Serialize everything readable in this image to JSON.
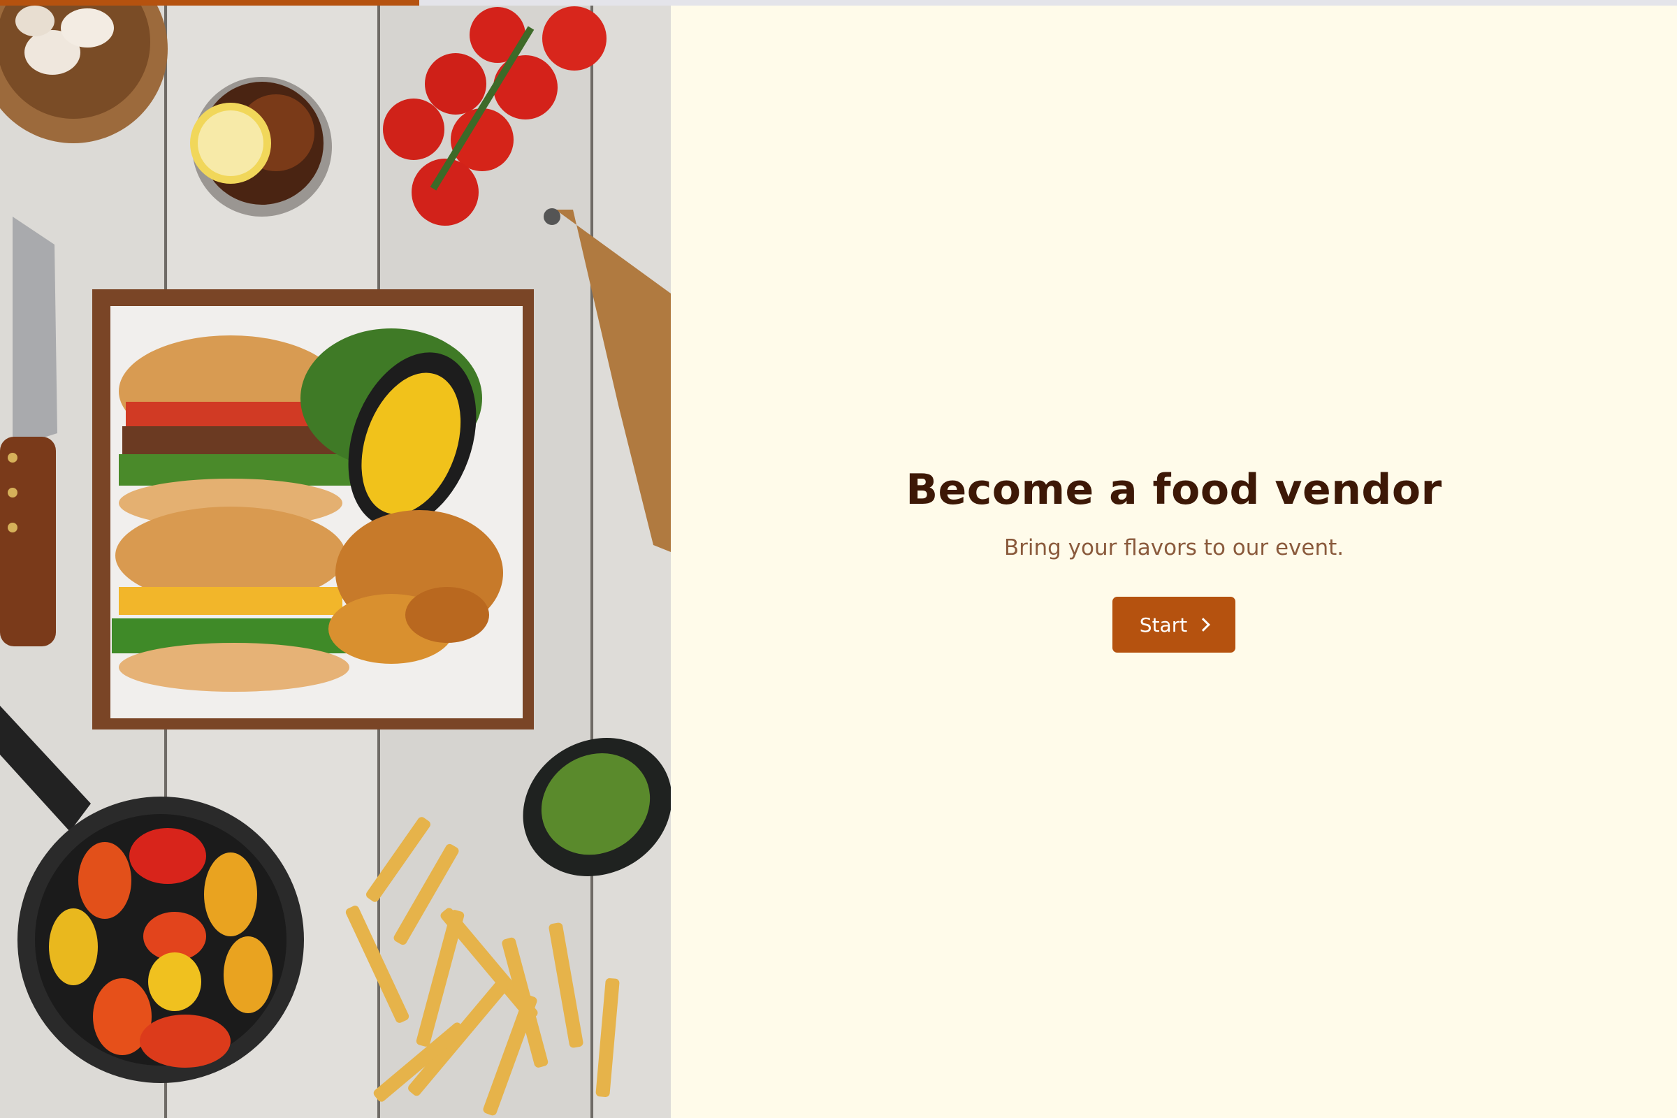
{
  "progress": {
    "value": 0.25
  },
  "hero": {
    "image": "food-spread-photo",
    "subjects": [
      "garlic",
      "iced drink with lemon",
      "cherry tomatoes",
      "knife",
      "burgers",
      "corn",
      "potato wedges",
      "pepper mill",
      "grilled peppers",
      "pickles",
      "french fries"
    ]
  },
  "intro": {
    "title": "Become a food vendor",
    "subtitle": "Bring your flavors to our event.",
    "start_label": "Start",
    "start_icon": "chevron-right-icon"
  },
  "colors": {
    "accent": "#b5520f",
    "background": "#fffbea",
    "title": "#3d1806",
    "subtitle": "#8a5a3c",
    "progress_track": "#e4e4ea"
  }
}
